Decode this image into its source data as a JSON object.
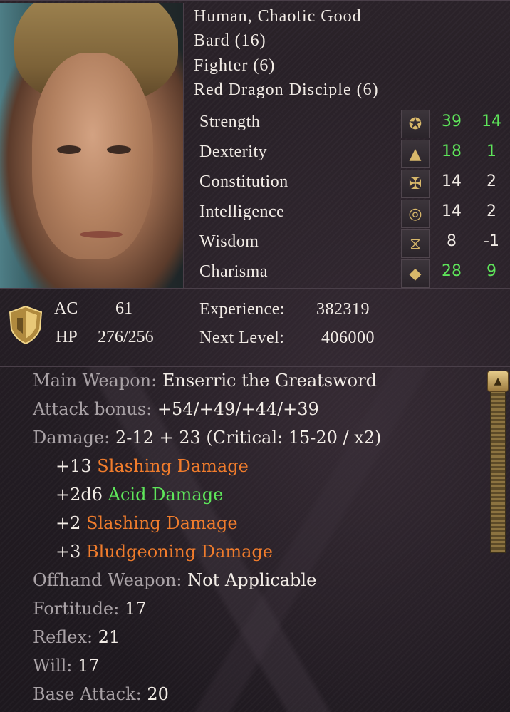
{
  "character": {
    "race_alignment": "Human, Chaotic Good",
    "classes": [
      "Bard (16)",
      "Fighter (6)",
      "Red Dragon Disciple (6)"
    ]
  },
  "abilities": [
    {
      "name": "Strength",
      "icon": "fist-icon",
      "score": "39",
      "modifier": "14",
      "boosted": true
    },
    {
      "name": "Dexterity",
      "icon": "triangle-icon",
      "score": "18",
      "modifier": "1",
      "boosted": true
    },
    {
      "name": "Constitution",
      "icon": "cross-icon",
      "score": "14",
      "modifier": "2",
      "boosted": false
    },
    {
      "name": "Intelligence",
      "icon": "ring-icon",
      "score": "14",
      "modifier": "2",
      "boosted": false
    },
    {
      "name": "Wisdom",
      "icon": "hourglass-icon",
      "score": "8",
      "modifier": "-1",
      "boosted": false
    },
    {
      "name": "Charisma",
      "icon": "diamond-icon",
      "score": "28",
      "modifier": "9",
      "boosted": true
    }
  ],
  "defense": {
    "ac_label": "AC",
    "ac_value": "61",
    "hp_label": "HP",
    "hp_value": "276/256"
  },
  "progress": {
    "experience_label": "Experience:",
    "experience_value": "382319",
    "next_level_label": "Next Level:",
    "next_level_value": "406000"
  },
  "combat": {
    "main_weapon_label": "Main Weapon:",
    "main_weapon_value": "Enserric the Greatsword",
    "attack_bonus_label": "Attack bonus:",
    "attack_bonus_value": "+54/+49/+44/+39",
    "damage_label": "Damage:",
    "damage_value": "2-12 + 23 (Critical: 15-20 / x2)",
    "bonus_damage": [
      {
        "amount": "+13",
        "type": "Slashing Damage",
        "color": "#f07c2c"
      },
      {
        "amount": "+2d6",
        "type": "Acid Damage",
        "color": "#5ee55a"
      },
      {
        "amount": "+2",
        "type": "Slashing Damage",
        "color": "#f07c2c"
      },
      {
        "amount": "+3",
        "type": "Bludgeoning Damage",
        "color": "#f07c2c"
      }
    ],
    "offhand_label": "Offhand Weapon:",
    "offhand_value": "Not Applicable",
    "fortitude_label": "Fortitude:",
    "fortitude_value": "17",
    "reflex_label": "Reflex:",
    "reflex_value": "21",
    "will_label": "Will:",
    "will_value": "17",
    "base_attack_label": "Base Attack:",
    "base_attack_value": "20"
  },
  "colors": {
    "boosted_stat": "#5ee55a",
    "label_gray": "#a9a2a6",
    "damage_orange": "#f07c2c",
    "scroll_gold": "#d8b86a"
  }
}
